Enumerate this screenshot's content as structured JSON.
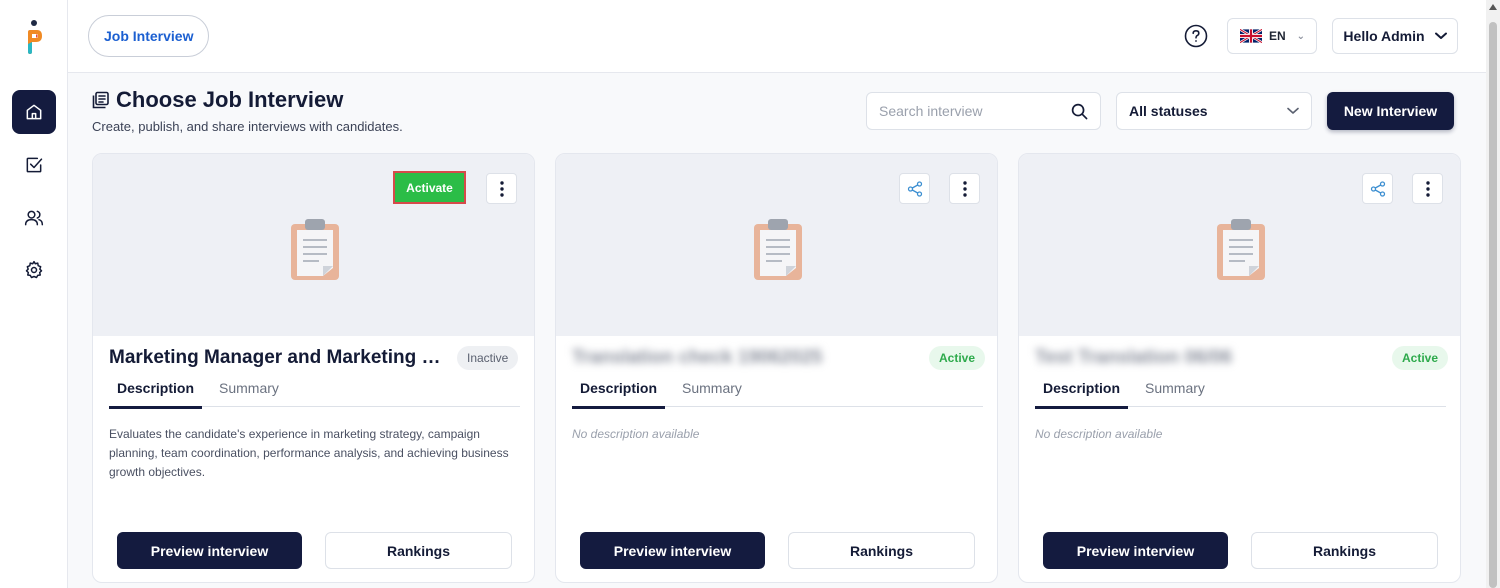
{
  "topbar": {
    "module_pill": "Job Interview",
    "language": "EN",
    "user_label": "Hello Admin"
  },
  "header": {
    "title": "Choose Job Interview",
    "subtitle": "Create, publish, and share interviews with candidates."
  },
  "search": {
    "placeholder": "Search interview",
    "value": ""
  },
  "status_filter": {
    "selected": "All statuses"
  },
  "new_interview_label": "New Interview",
  "cards": [
    {
      "title": "Marketing Manager and Marketing Strategy Lead",
      "status": "Inactive",
      "activate_label": "Activate",
      "tabs": [
        "Description",
        "Summary"
      ],
      "description": "Evaluates the candidate's experience in marketing strategy, campaign planning, team coordination, performance analysis, and achieving business growth objectives.",
      "preview_label": "Preview interview",
      "rankings_label": "Rankings"
    },
    {
      "title": "Translation check 19062025",
      "status": "Active",
      "tabs": [
        "Description",
        "Summary"
      ],
      "description": "No description available",
      "preview_label": "Preview interview",
      "rankings_label": "Rankings"
    },
    {
      "title": "Test Translation 06/06",
      "status": "Active",
      "tabs": [
        "Description",
        "Summary"
      ],
      "description": "No description available",
      "preview_label": "Preview interview",
      "rankings_label": "Rankings"
    }
  ],
  "colors": {
    "primary": "#141b3f",
    "activate_green": "#2bbd47",
    "active_badge": "#2eaa4c",
    "link_blue": "#1b5fd1"
  }
}
